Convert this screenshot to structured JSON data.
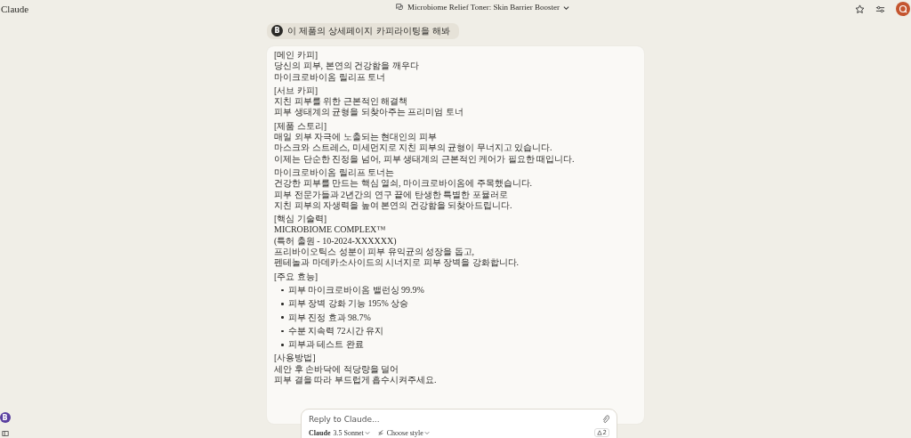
{
  "app": {
    "name": "Claude"
  },
  "header": {
    "title": "Microbiome Relief Toner: Skin Barrier Booster"
  },
  "user_message": {
    "avatar": "B",
    "text": "이 제품의 상세페이지 카피라이팅을 해봐"
  },
  "response": {
    "blocks": [
      {
        "kind": "paragraph",
        "lines": [
          "[메인 카피]",
          "당신의 피부, 본연의 건강함을 깨우다",
          "마이크로바이옴 릴리프 토너"
        ]
      },
      {
        "kind": "paragraph",
        "lines": [
          "[서브 카피]",
          "지친 피부를 위한 근본적인 해결책",
          "피부 생태계의 균형을 되찾아주는 프리미엄 토너"
        ]
      },
      {
        "kind": "paragraph",
        "lines": [
          "[제품 스토리]",
          "매일 외부 자극에 노출되는 현대인의 피부",
          "마스크와 스트레스, 미세먼지로 지친 피부의 균형이 무너지고 있습니다.",
          "이제는 단순한 진정을 넘어, 피부 생태계의 근본적인 케어가 필요한 때입니다."
        ]
      },
      {
        "kind": "paragraph",
        "lines": [
          "마이크로바이옴 릴리프 토너는",
          "건강한 피부를 만드는 핵심 열쇠, 마이크로바이옴에 주목했습니다.",
          "피부 전문가들과 2년간의 연구 끝에 탄생한 특별한 포뮬러로",
          "지친 피부의 자생력을 높여 본연의 건강함을 되찾아드립니다."
        ]
      },
      {
        "kind": "paragraph",
        "lines": [
          "[핵심 기술력]",
          "MICROBIOME COMPLEX™",
          "(특허 출원 - 10-2024-XXXXXX)",
          "프리바이오틱스 성분이 피부 유익균의 성장을 돕고,",
          "펜테놀과 마데카소사이드의 시너지로 피부 장벽을 강화합니다."
        ]
      },
      {
        "kind": "paragraph",
        "lines": [
          "[주요 효능]"
        ]
      },
      {
        "kind": "list",
        "lines": [
          "피부 마이크로바이옴 밸런싱 99.9%",
          "피부 장벽 강화 기능 195% 상승",
          "피부 진정 효과 98.7%",
          "수분 지속력 72시간 유지",
          "피부과 테스트 완료"
        ]
      },
      {
        "kind": "paragraph",
        "lines": [
          "[사용방법]",
          "세안 후 손바닥에 적당량을 덜어",
          "피부 결을 따라 부드럽게 흡수시켜주세요."
        ]
      }
    ]
  },
  "composer": {
    "placeholder": "Reply to Claude...",
    "model_name": "Claude",
    "model_version": "3.5 Sonnet",
    "style_label": "Choose style",
    "count": "2"
  },
  "sidebar": {
    "avatar": "B"
  }
}
